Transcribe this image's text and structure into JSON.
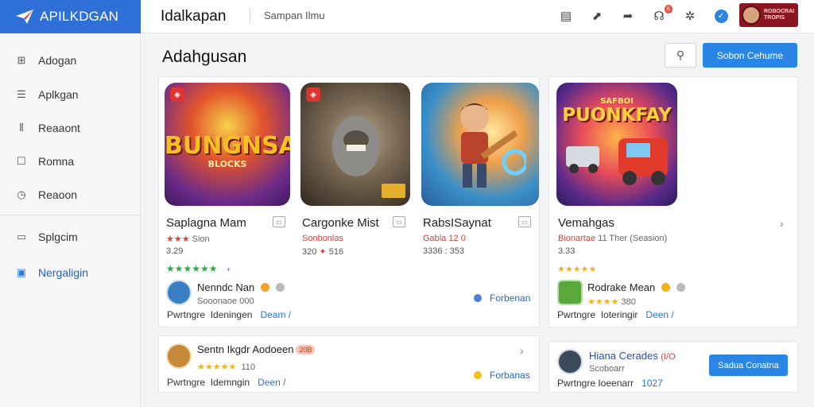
{
  "brand": {
    "name": "APILKDGAN",
    "color": "#2e6fd8"
  },
  "header": {
    "title": "Idalkapan",
    "subtitle": "Sampan Ilmu",
    "icons": [
      "window-icon",
      "share-icon",
      "forward-icon",
      "gamepad-icon",
      "gear-icon",
      "verified-icon"
    ],
    "notification_count": "6",
    "user_chip_text": [
      "ROBOCRAI",
      "TROPIS"
    ]
  },
  "sidebar": {
    "items": [
      {
        "label": "Adogan",
        "icon": "grid-icon"
      },
      {
        "label": "Aplkgan",
        "icon": "list-icon"
      },
      {
        "label": "Reaaont",
        "icon": "chart-icon"
      },
      {
        "label": "Romna",
        "icon": "square-icon"
      },
      {
        "label": "Reaoon",
        "icon": "clock-icon"
      },
      {
        "label": "Splgcim",
        "icon": "display-icon"
      },
      {
        "label": "Nergaligin",
        "icon": "save-icon"
      }
    ],
    "active_index": 6
  },
  "main": {
    "heading": "Adahgusan",
    "search_icon": "pin-icon",
    "primary_button": "Sobon Cehume"
  },
  "games": [
    {
      "art_text": "BUNGNSA",
      "art_sub": "BLOCKS",
      "title": "Saplagna Mam",
      "rating_stars": "★★★",
      "rating_text": "Sion",
      "price": "3.29"
    },
    {
      "art_text": "",
      "art_sub": "",
      "title": "Cargonke Mist",
      "rating_text": "Sonbonlas",
      "price_main": "320",
      "price_tag": "516"
    },
    {
      "art_text": "",
      "art_sub": "",
      "title": "RabsISaynat",
      "rating_text": "Gabla 12 0",
      "price": "3336 : 353"
    },
    {
      "art_text": "PUONKFAY",
      "art_sub": "SAFBOI",
      "title": "Vemahgas",
      "rating_text": "Bionartae",
      "rating_extra": "11 Ther (Seasion)",
      "price": "3.33"
    }
  ],
  "left_card": {
    "stars": "★★★★★★",
    "stars_suffix": "+",
    "user_name": "Nenndc Nan",
    "user_meta": "Sooonaoe 000",
    "foot_a": "Pwrtngre",
    "foot_b": "Ideningen",
    "foot_link": "Deam /",
    "follow": "Forbenan"
  },
  "right_card": {
    "stars": "★★★★★",
    "user_name": "Rodrake Mean",
    "user_stars": "★★★★",
    "user_meta": "380",
    "foot_a": "Pwrtngre",
    "foot_b": "Ioteringir",
    "foot_link": "Deen /"
  },
  "bottom_left": {
    "user_name": "Sentn Ikgdr Aodoeen",
    "tag": "20B",
    "stars": "★★★★★",
    "meta": "110",
    "foot_a": "Pwrtngre",
    "foot_b": "Idemngin",
    "foot_link": "Deen /",
    "follow": "Forbanas"
  },
  "bottom_right": {
    "user_name": "Hiana Cerades",
    "tag": "(I/O",
    "meta": "Scoboarr",
    "foot": "Pwrtngre Ioeenarr",
    "foot_num": "1027",
    "button": "Sadua Conatna"
  }
}
